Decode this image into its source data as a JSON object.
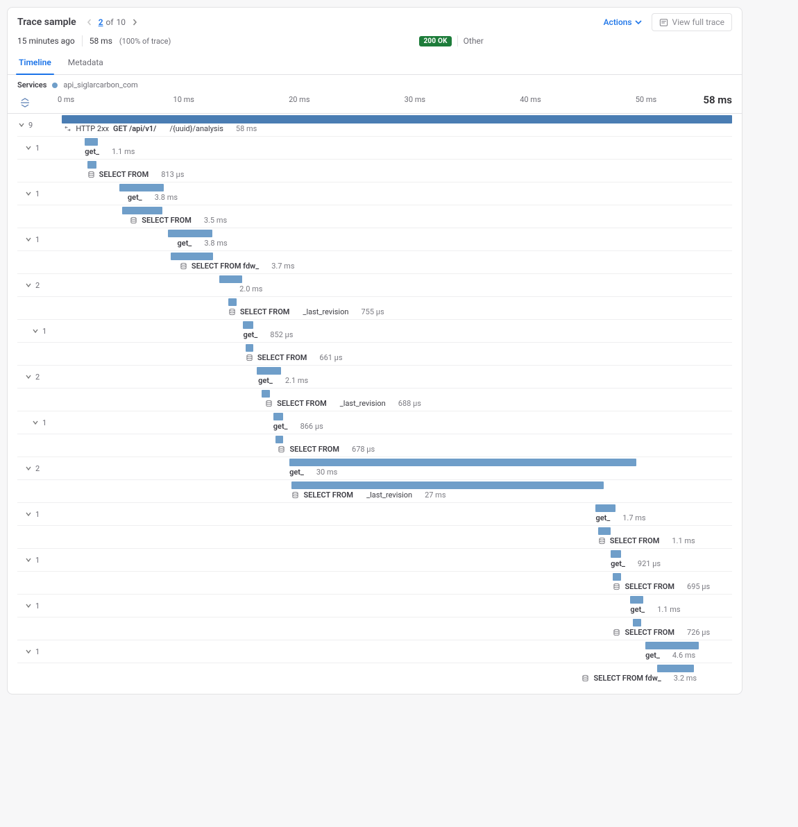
{
  "header": {
    "title": "Trace sample",
    "pager": {
      "current": 2,
      "of_word": "of",
      "total": 10
    },
    "actions_label": "Actions",
    "view_full_trace": "View full trace"
  },
  "meta": {
    "age": "15 minutes ago",
    "duration": "58 ms",
    "trace_pct": "(100% of trace)",
    "status_badge": "200 OK",
    "kind": "Other"
  },
  "tabs": {
    "timeline": "Timeline",
    "metadata": "Metadata",
    "active": "timeline"
  },
  "services": {
    "label": "Services",
    "name": "api_siglarcarbon_com"
  },
  "axis": {
    "ticks": [
      "0 ms",
      "10 ms",
      "20 ms",
      "30 ms",
      "40 ms",
      "50 ms"
    ],
    "total_label": "58 ms",
    "total_ms": 58
  },
  "spans": [
    {
      "id": "root",
      "depth": 0,
      "count": 9,
      "kind": "http",
      "label_prefix": "HTTP 2xx",
      "label_strong": "GET /api/v1/",
      "label_tail": "/{uuid}/analysis",
      "dur_label": "58 ms",
      "start": 0,
      "dur": 58,
      "root": true,
      "label_at": 0.2
    },
    {
      "id": "g1",
      "depth": 1,
      "count": 1,
      "kind": "fn",
      "label_strong": "get_",
      "dur_label": "1.1 ms",
      "start": 2.0,
      "dur": 1.1,
      "label_at": 2.0
    },
    {
      "id": "s1",
      "depth": 2,
      "kind": "db",
      "label_strong": "SELECT FROM",
      "dur_label": "813 µs",
      "start": 2.2,
      "dur": 0.813,
      "label_at": 2.2
    },
    {
      "id": "g2",
      "depth": 1,
      "count": 1,
      "kind": "fn",
      "label_strong": "get_",
      "dur_label": "3.8 ms",
      "start": 5.0,
      "dur": 3.8,
      "label_at": 5.7
    },
    {
      "id": "s2",
      "depth": 2,
      "kind": "db",
      "label_strong": "SELECT FROM",
      "dur_label": "3.5 ms",
      "start": 5.2,
      "dur": 3.5,
      "label_at": 5.9
    },
    {
      "id": "g3",
      "depth": 1,
      "count": 1,
      "kind": "fn",
      "label_strong": "get_",
      "dur_label": "3.8 ms",
      "start": 9.2,
      "dur": 3.8,
      "label_at": 10.0
    },
    {
      "id": "s3",
      "depth": 2,
      "kind": "db",
      "label_strong": "SELECT FROM fdw_",
      "dur_label": "3.7 ms",
      "start": 9.4,
      "dur": 3.7,
      "label_at": 10.2
    },
    {
      "id": "g4",
      "depth": 1,
      "count": 2,
      "kind": "fn",
      "label_strong": "",
      "dur_label": "2.0 ms",
      "start": 13.6,
      "dur": 2.0,
      "label_at": 14.3
    },
    {
      "id": "s4",
      "depth": 2,
      "kind": "db",
      "label_strong": "SELECT FROM",
      "label_tail": "_last_revision",
      "dur_label": "755 µs",
      "start": 14.4,
      "dur": 0.755,
      "label_at": 14.4
    },
    {
      "id": "g5",
      "depth": 2,
      "count": 1,
      "kind": "fn",
      "label_strong": "get_",
      "dur_label": "852 µs",
      "start": 15.7,
      "dur": 0.852,
      "label_at": 15.7
    },
    {
      "id": "s5",
      "depth": 2,
      "kind": "db",
      "label_strong": "SELECT FROM",
      "dur_label": "661 µs",
      "start": 15.9,
      "dur": 0.661,
      "label_at": 15.9
    },
    {
      "id": "g6",
      "depth": 1,
      "count": 2,
      "kind": "fn",
      "label_strong": "get_",
      "dur_label": "2.1 ms",
      "start": 16.9,
      "dur": 2.1,
      "label_at": 17.0
    },
    {
      "id": "s6",
      "depth": 2,
      "kind": "db",
      "label_strong": "SELECT FROM",
      "label_tail": "_last_revision",
      "dur_label": "688 µs",
      "start": 17.3,
      "dur": 0.688,
      "label_at": 17.6
    },
    {
      "id": "g7",
      "depth": 2,
      "count": 1,
      "kind": "fn",
      "label_strong": "get_",
      "dur_label": "866 µs",
      "start": 18.3,
      "dur": 0.866,
      "label_at": 18.3
    },
    {
      "id": "s7",
      "depth": 2,
      "kind": "db",
      "label_strong": "SELECT FROM",
      "dur_label": "678 µs",
      "start": 18.5,
      "dur": 0.678,
      "label_at": 18.7
    },
    {
      "id": "g8",
      "depth": 1,
      "count": 2,
      "kind": "fn",
      "label_strong": "get_",
      "dur_label": "30 ms",
      "start": 19.7,
      "dur": 30,
      "label_at": 19.7
    },
    {
      "id": "s8",
      "depth": 2,
      "kind": "db",
      "label_strong": "SELECT FROM",
      "label_tail": "_last_revision",
      "dur_label": "27 ms",
      "start": 19.9,
      "dur": 27,
      "label_at": 19.9
    },
    {
      "id": "g9",
      "depth": 1,
      "count": 1,
      "kind": "fn",
      "label_strong": "get_",
      "dur_label": "1.7 ms",
      "start": 46.2,
      "dur": 1.7,
      "label_at": 46.2
    },
    {
      "id": "s9",
      "depth": 2,
      "kind": "db",
      "label_strong": "SELECT FROM",
      "dur_label": "1.1 ms",
      "start": 46.4,
      "dur": 1.1,
      "label_at": 46.4
    },
    {
      "id": "g10",
      "depth": 1,
      "count": 1,
      "kind": "fn",
      "label_strong": "get_",
      "dur_label": "921 µs",
      "start": 47.5,
      "dur": 0.921,
      "label_at": 47.5
    },
    {
      "id": "s10",
      "depth": 2,
      "kind": "db",
      "label_strong": "SELECT FROM",
      "dur_label": "695 µs",
      "start": 47.7,
      "dur": 0.695,
      "label_at": 47.7
    },
    {
      "id": "g11",
      "depth": 1,
      "count": 1,
      "kind": "fn",
      "label_strong": "get_",
      "dur_label": "1.1 ms",
      "start": 49.2,
      "dur": 1.1,
      "label_at": 49.2
    },
    {
      "id": "s11",
      "depth": 2,
      "kind": "db",
      "label_strong": "SELECT FROM",
      "dur_label": "726 µs",
      "start": 49.4,
      "dur": 0.726,
      "label_at": 47.7
    },
    {
      "id": "g12",
      "depth": 1,
      "count": 1,
      "kind": "fn",
      "label_strong": "get_",
      "dur_label": "4.6 ms",
      "start": 50.5,
      "dur": 4.6,
      "label_at": 50.5
    },
    {
      "id": "s12",
      "depth": 2,
      "kind": "db",
      "label_strong": "SELECT FROM fdw_",
      "dur_label": "3.2 ms",
      "start": 51.5,
      "dur": 3.2,
      "label_at": 45.0
    }
  ]
}
